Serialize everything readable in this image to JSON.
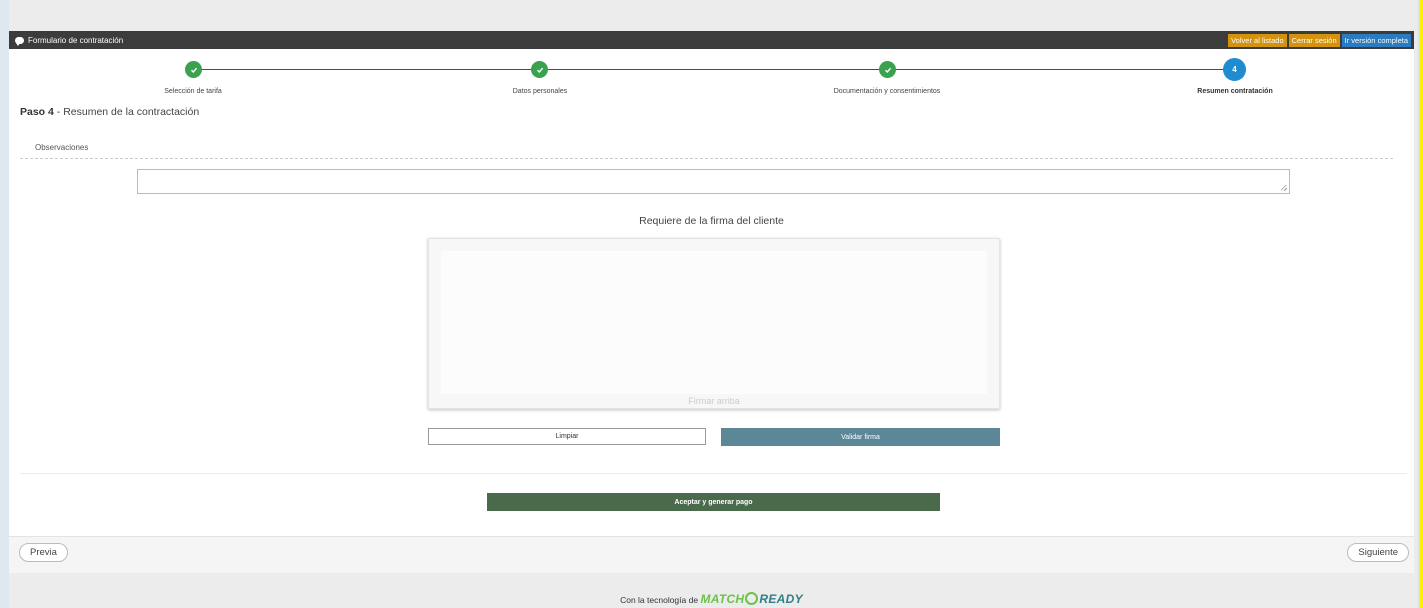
{
  "header": {
    "title": "Formulario de contratación",
    "buttons": [
      {
        "label": "Volver al listado",
        "color": "#d4930e"
      },
      {
        "label": "Cerrar sesión",
        "color": "#d4930e"
      },
      {
        "label": "Ir versión completa",
        "color": "#2a7bbf"
      }
    ]
  },
  "steps": [
    {
      "label": "Selección de tarifa",
      "status": "done"
    },
    {
      "label": "Datos personales",
      "status": "done"
    },
    {
      "label": "Documentación y consentimientos",
      "status": "done"
    },
    {
      "label": "Resumen contratación",
      "status": "current",
      "number": "4"
    }
  ],
  "page": {
    "step_prefix": "Paso 4",
    "step_title": " - Resumen de la contractación"
  },
  "observations": {
    "label": "Observaciones",
    "value": ""
  },
  "signature": {
    "title": "Requiere de la firma del cliente",
    "hint": "Firmar arriba",
    "clear_label": "Limpiar",
    "validate_label": "Validar firma"
  },
  "actions": {
    "accept_label": "Aceptar y generar pago"
  },
  "nav": {
    "prev_label": "Previa",
    "next_label": "Siguiente"
  },
  "footer": {
    "text": "Con la tecnología de",
    "brand_part1": "MATCH",
    "brand_part2": "READY"
  },
  "colors": {
    "done": "#3aa24f",
    "current": "#1e8ccf",
    "accept": "#4a6a4c",
    "validate": "#5b8797"
  }
}
